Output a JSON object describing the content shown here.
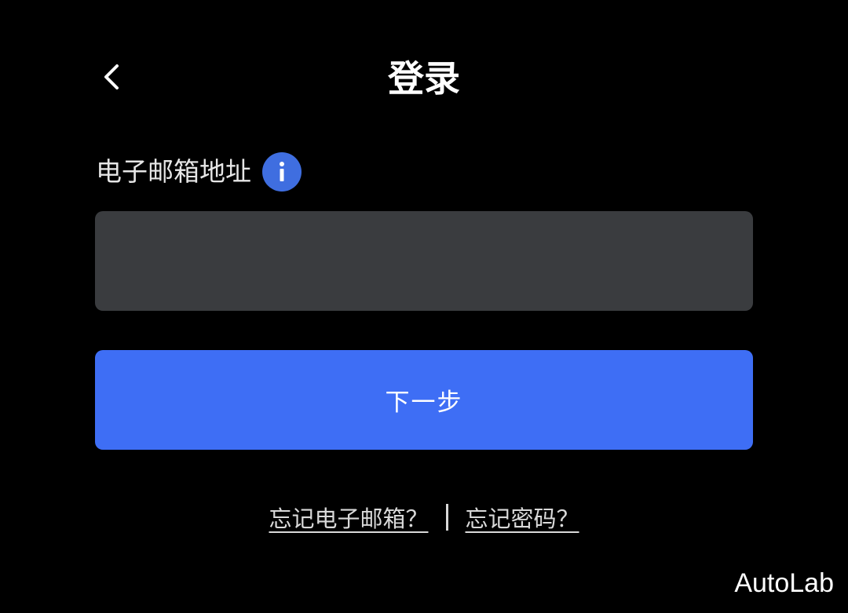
{
  "header": {
    "back_icon": "chevron-left-icon",
    "title": "登录"
  },
  "form": {
    "email_label": "电子邮箱地址",
    "info_icon": "info-icon",
    "email_value": "",
    "email_placeholder": "",
    "next_label": "下一步"
  },
  "links": {
    "forgot_email": "忘记电子邮箱？",
    "forgot_password": "忘记密码？"
  },
  "watermark": "AutoLab",
  "colors": {
    "background": "#000000",
    "input_bg": "#3a3c3f",
    "primary": "#3e6ef5",
    "info_badge": "#3f6ee0",
    "text": "#ffffff"
  }
}
